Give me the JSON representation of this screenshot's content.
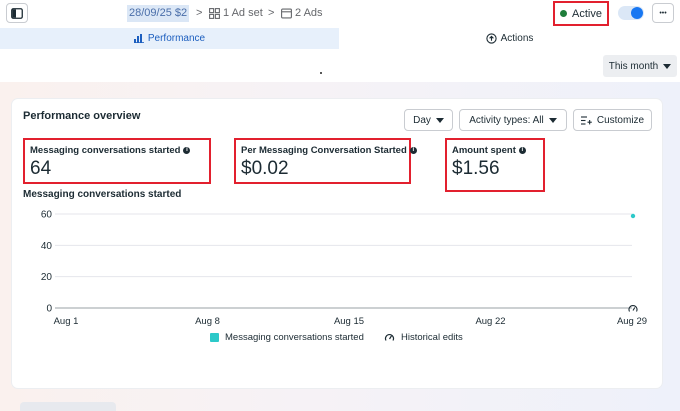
{
  "breadcrumb": {
    "campaign": "28/09/25 $2",
    "separator": ">",
    "adset_label": "1 Ad set",
    "ads_label": "2 Ads"
  },
  "status": {
    "label": "Active",
    "color": "#1e7d3a"
  },
  "toggle": {
    "on": true,
    "color": "#1877f2"
  },
  "more_label": "•••",
  "tabs": [
    {
      "label": "Performance",
      "active": true,
      "icon": "bar-chart-icon"
    },
    {
      "label": "Actions",
      "active": false,
      "icon": "upload-circle-icon"
    }
  ],
  "date_range": {
    "label": "This month"
  },
  "overview": {
    "title": "Performance overview",
    "granularity": "Day",
    "activity_filter": "Activity types: All",
    "customize_label": "Customize"
  },
  "metrics": [
    {
      "label": "Messaging conversations started",
      "value": "64"
    },
    {
      "label": "Per Messaging Conversation Started",
      "value": "$0.02"
    },
    {
      "label": "Amount spent",
      "value": "$1.56"
    }
  ],
  "chart_data": {
    "type": "line",
    "title": "Messaging conversations started",
    "xlabel": "",
    "ylabel": "",
    "x_ticks": [
      "Aug 1",
      "Aug 8",
      "Aug 15",
      "Aug 22",
      "Aug 29"
    ],
    "y_ticks": [
      0,
      20,
      40,
      60
    ],
    "ylim": [
      0,
      60
    ],
    "xlim": [
      "Aug 1",
      "Aug 29"
    ],
    "series": [
      {
        "name": "Messaging conversations started",
        "color": "#2cc9c9",
        "points": [
          {
            "x": "Aug 29",
            "y": 64
          }
        ]
      }
    ],
    "annotations": [
      {
        "x": "Aug 29",
        "type": "historical-edit"
      }
    ],
    "legend": [
      "Messaging conversations started",
      "Historical edits"
    ],
    "grid": true
  }
}
